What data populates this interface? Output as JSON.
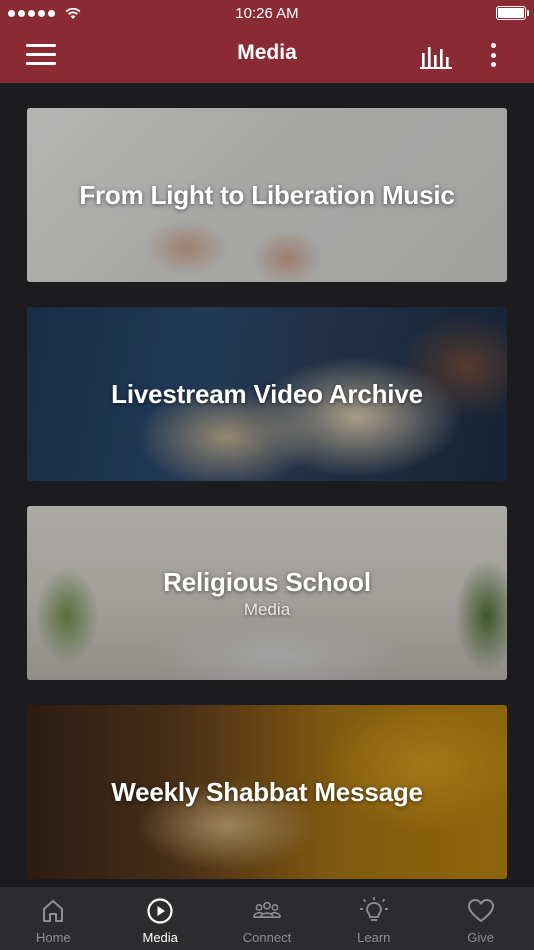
{
  "status_bar": {
    "time": "10:26 AM",
    "signal_icon": "signal-dots-icon",
    "wifi_icon": "wifi-icon",
    "battery_icon": "battery-icon"
  },
  "header": {
    "title": "Media",
    "menu_icon": "hamburger-menu-icon",
    "bars_icon": "audio-bars-icon",
    "more_icon": "more-vertical-icon",
    "color": "#8a2b33"
  },
  "cards": [
    {
      "title": "From Light to Liberation Music",
      "subtitle": ""
    },
    {
      "title": "Livestream Video Archive",
      "subtitle": ""
    },
    {
      "title": "Religious School",
      "subtitle": "Media"
    },
    {
      "title": "Weekly Shabbat Message",
      "subtitle": ""
    }
  ],
  "tabs": [
    {
      "label": "Home",
      "icon": "home-icon",
      "active": false
    },
    {
      "label": "Media",
      "icon": "play-circle-icon",
      "active": true
    },
    {
      "label": "Connect",
      "icon": "group-icon",
      "active": false
    },
    {
      "label": "Learn",
      "icon": "lightbulb-icon",
      "active": false
    },
    {
      "label": "Give",
      "icon": "heart-icon",
      "active": false
    }
  ]
}
